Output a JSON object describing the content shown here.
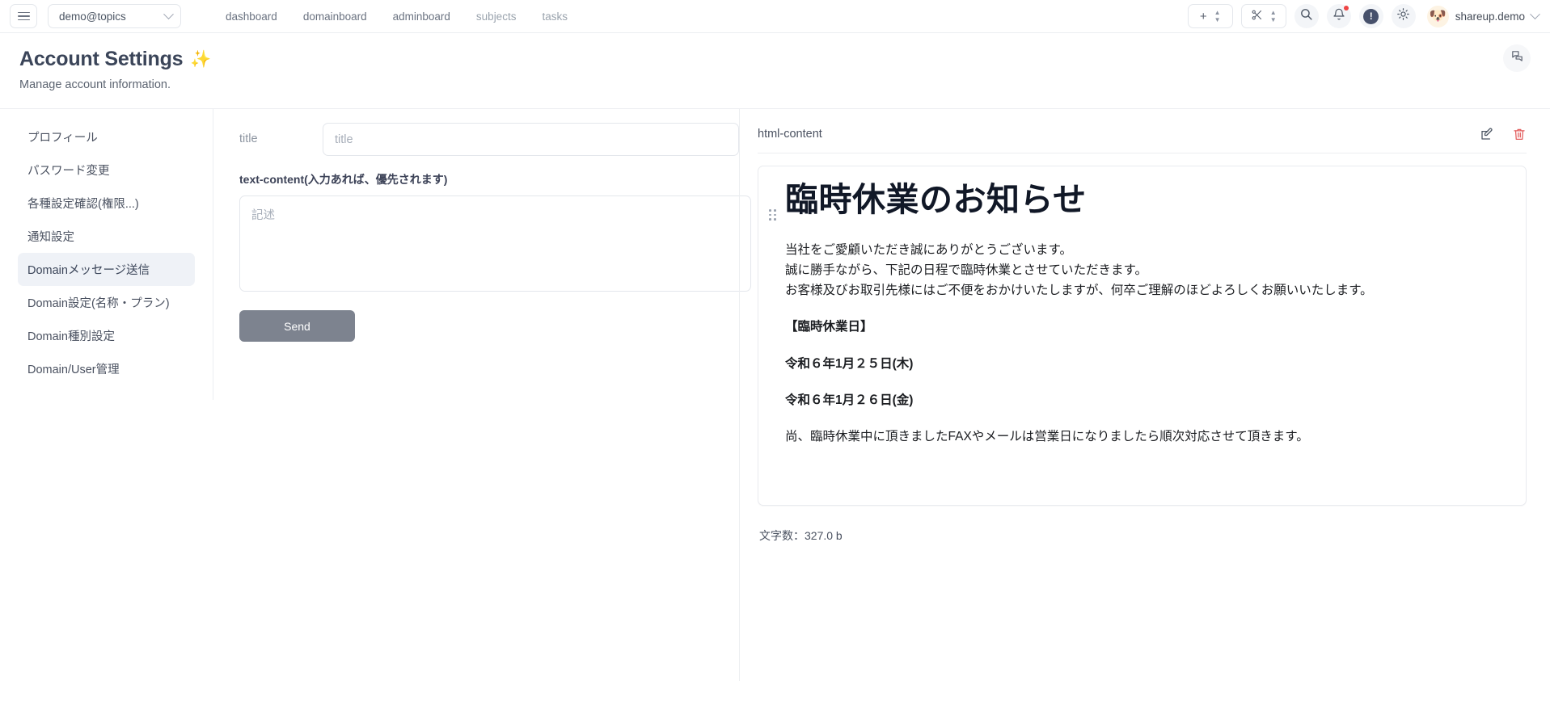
{
  "topbar": {
    "menu_icon": "hamburger-icon",
    "domain_selector": {
      "value": "demo@topics",
      "chevron": "chevron-down-icon"
    },
    "nav": [
      {
        "label": "dashboard",
        "dim": false
      },
      {
        "label": "domainboard",
        "dim": false
      },
      {
        "label": "adminboard",
        "dim": false
      },
      {
        "label": "subjects",
        "dim": true
      },
      {
        "label": "tasks",
        "dim": true
      }
    ],
    "add_stepper": {
      "glyph": "+",
      "icon": "plus-icon"
    },
    "cut_stepper": {
      "glyph": "✂",
      "icon": "scissors-icon"
    },
    "search_icon": "search-icon",
    "bell_icon": "bell-icon",
    "info_glyph": "!",
    "info_icon": "info-circle-icon",
    "brightness_icon": "sun-icon",
    "avatar_glyph": "🐶",
    "user_name": "shareup.demo",
    "user_chevron": "chevron-down-icon"
  },
  "page": {
    "title": "Account Settings",
    "title_emoji": "✨",
    "subtitle": "Manage account information.",
    "chat_icon": "chat-bubbles-icon"
  },
  "sidebar": {
    "items": [
      {
        "label": "プロフィール",
        "active": false
      },
      {
        "label": "パスワード変更",
        "active": false
      },
      {
        "label": "各種設定確認(権限...)",
        "active": false
      },
      {
        "label": "通知設定",
        "active": false
      },
      {
        "label": "Domainメッセージ送信",
        "active": true
      },
      {
        "label": "Domain設定(名称・プラン)",
        "active": false
      },
      {
        "label": "Domain種別設定",
        "active": false
      },
      {
        "label": "Domain/User管理",
        "active": false
      }
    ]
  },
  "form": {
    "title_label": "title",
    "title_value": "",
    "title_placeholder": "title",
    "textcontent_label": "text-content(入力あれば、優先されます)",
    "textcontent_value": "",
    "textcontent_placeholder": "記述",
    "send_label": "Send"
  },
  "preview": {
    "panel_title": "html-content",
    "edit_icon": "edit-pencil-icon",
    "delete_icon": "trash-icon",
    "drag_icon": "drag-handle-icon",
    "heading": "臨時休業のお知らせ",
    "paragraphs": [
      "当社をご愛顧いただき誠にありがとうございます。",
      "誠に勝手ながら、下記の日程で臨時休業とさせていただきます。",
      "お客様及びお取引先様にはご不便をおかけいたしますが、何卒ご理解のほどよろしくお願いいたします。"
    ],
    "section_label": "【臨時休業日】",
    "date_1": "令和６年1月２５日(木)",
    "date_2": "令和６年1月２６日(金)",
    "closing": "尚、臨時休業中に頂きましたFAXやメールは営業日になりましたら順次対応させて頂きます。",
    "charcount": "文字数：327.0 b"
  },
  "colors": {
    "accent_active_bg": "#eff2f7",
    "send_button": "#7d838f",
    "delete_red": "#e35d5d",
    "badge_red": "#ef4444",
    "info_navy": "#46506b",
    "heading_navy": "#3b4559"
  }
}
